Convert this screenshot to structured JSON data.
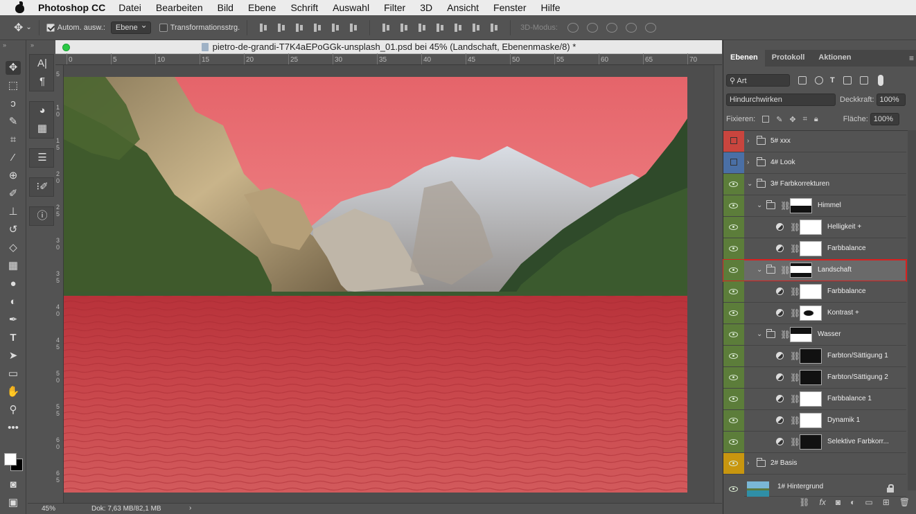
{
  "menubar": {
    "app": "Photoshop CC",
    "items": [
      "Datei",
      "Bearbeiten",
      "Bild",
      "Ebene",
      "Schrift",
      "Auswahl",
      "Filter",
      "3D",
      "Ansicht",
      "Fenster",
      "Hilfe"
    ]
  },
  "options": {
    "auto_select_label": "Autom. ausw.:",
    "auto_select_checked": true,
    "auto_select_value": "Ebene",
    "transform_label": "Transformationsstrg.",
    "transform_checked": false,
    "mode3d_label": "3D-Modus:"
  },
  "document": {
    "title": "pietro-de-grandi-T7K4aEPoGGk-unsplash_01.psd bei 45% (Landschaft, Ebenenmaske/8) *",
    "ruler_h_ticks": [
      "0",
      "5",
      "10",
      "15",
      "20",
      "25",
      "30",
      "35",
      "40",
      "45",
      "50",
      "55",
      "60",
      "65",
      "70"
    ],
    "ruler_v_ticks": [
      "5",
      "1\n0",
      "1\n5",
      "2\n0",
      "2\n5",
      "3\n0",
      "3\n5",
      "4\n0",
      "4\n5",
      "5\n0",
      "5\n5",
      "6\n0",
      "6\n5"
    ]
  },
  "status": {
    "zoom": "45%",
    "doc": "Dok: 7,63 MB/82,1 MB",
    "arrow": "›"
  },
  "panel": {
    "tabs": [
      "Ebenen",
      "Protokoll",
      "Aktionen"
    ],
    "filter_kind": "Art",
    "blend_mode": "Hindurchwirken",
    "opacity_label": "Deckkraft:",
    "opacity_value": "100%",
    "lock_label": "Fixieren:",
    "fill_label": "Fläche:",
    "fill_value": "100%",
    "layers": [
      {
        "name": "5# xxx",
        "type": "group",
        "indent": 0,
        "collapsed": true,
        "eye_color": "#c9453e",
        "visible": false
      },
      {
        "name": "4# Look",
        "type": "group",
        "indent": 0,
        "collapsed": true,
        "eye_color": "#4a6fa5",
        "visible": false
      },
      {
        "name": "3# Farbkorrekturen",
        "type": "group",
        "indent": 0,
        "collapsed": false,
        "eye_color": "#5c7d3a",
        "visible": true
      },
      {
        "name": "Himmel",
        "type": "group-mask",
        "indent": 1,
        "collapsed": false,
        "eye_color": "#5c7d3a",
        "visible": true
      },
      {
        "name": "Helligkeit +",
        "type": "adjust",
        "indent": 2,
        "eye_color": "#5c7d3a",
        "visible": true
      },
      {
        "name": "Farbbalance",
        "type": "adjust",
        "indent": 2,
        "eye_color": "#5c7d3a",
        "visible": true
      },
      {
        "name": "Landschaft",
        "type": "group-mask",
        "indent": 1,
        "collapsed": false,
        "eye_color": "#5c7d3a",
        "visible": true,
        "selected": true
      },
      {
        "name": "Farbbalance",
        "type": "adjust",
        "indent": 2,
        "eye_color": "#5c7d3a",
        "visible": true
      },
      {
        "name": "Kontrast +",
        "type": "adjust",
        "indent": 2,
        "eye_color": "#5c7d3a",
        "visible": true
      },
      {
        "name": "Wasser",
        "type": "group-mask",
        "indent": 1,
        "collapsed": false,
        "eye_color": "#5c7d3a",
        "visible": true
      },
      {
        "name": "Farbton/Sättigung 1",
        "type": "adjust",
        "indent": 2,
        "eye_color": "#5c7d3a",
        "visible": true
      },
      {
        "name": "Farbton/Sättigung 2",
        "type": "adjust",
        "indent": 2,
        "eye_color": "#5c7d3a",
        "visible": true
      },
      {
        "name": "Farbbalance 1",
        "type": "adjust",
        "indent": 2,
        "eye_color": "#5c7d3a",
        "visible": true
      },
      {
        "name": "Dynamik 1",
        "type": "adjust",
        "indent": 2,
        "eye_color": "#5c7d3a",
        "visible": true
      },
      {
        "name": "Selektive Farbkorr...",
        "type": "adjust",
        "indent": 2,
        "eye_color": "#5c7d3a",
        "visible": true
      },
      {
        "name": "2# Basis",
        "type": "group",
        "indent": 0,
        "collapsed": true,
        "eye_color": "#c8960f",
        "visible": true
      },
      {
        "name": "1# Hintergrund",
        "type": "image",
        "indent": 0,
        "eye_color": "#535353",
        "visible": true,
        "locked": true
      }
    ],
    "footer_icons": [
      "link-icon",
      "fx-icon",
      "mask-icon",
      "adjustment-icon",
      "new-group-icon",
      "new-layer-icon",
      "trash-icon"
    ]
  },
  "tools": [
    "move-icon",
    "marquee-icon",
    "lasso-icon",
    "quick-select-icon",
    "crop-icon",
    "eyedropper-icon",
    "healing-icon",
    "brush-icon",
    "stamp-icon",
    "history-brush-icon",
    "eraser-icon",
    "gradient-icon",
    "blur-icon",
    "dodge-icon",
    "pen-icon",
    "type-icon",
    "path-select-icon",
    "rectangle-icon",
    "hand-icon",
    "zoom-icon",
    "more-icon"
  ]
}
